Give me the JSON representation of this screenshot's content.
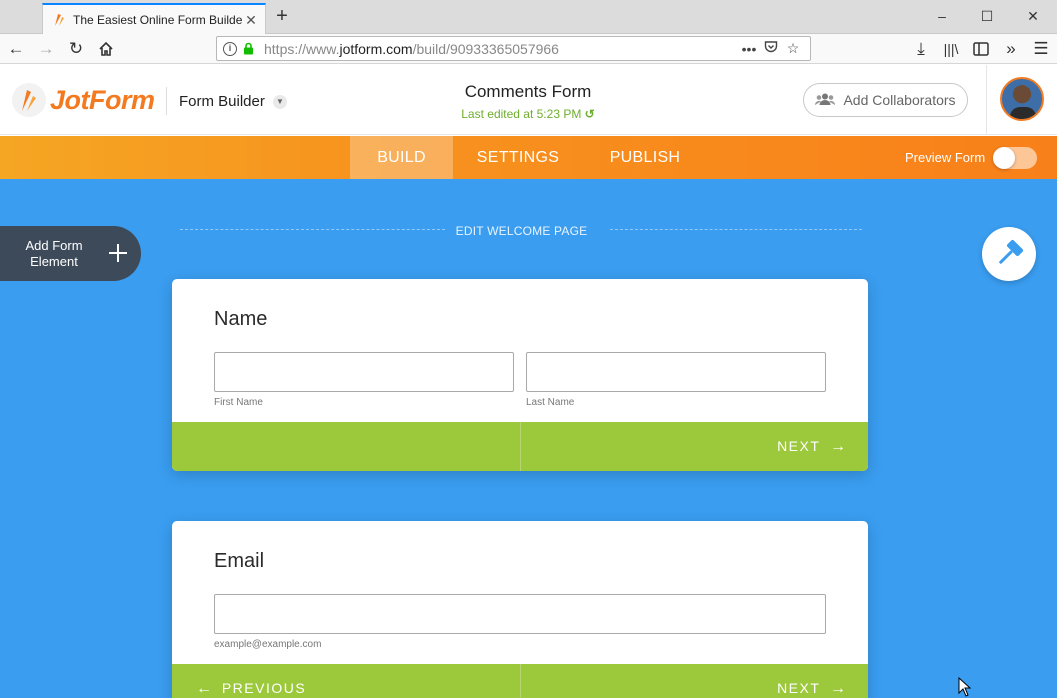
{
  "browser": {
    "tab_title": "The Easiest Online Form Builder",
    "new_tab_symbol": "+",
    "url_prefix": "https://www.",
    "url_host": "jotform.com",
    "url_path": "/build/90933365057966"
  },
  "header": {
    "logo_text": "JotForm",
    "builder_label": "Form Builder",
    "form_title": "Comments Form",
    "last_edited": "Last edited at 5:23 PM",
    "collaborators_label": "Add Collaborators"
  },
  "nav": {
    "tabs": [
      {
        "label": "BUILD",
        "active": true
      },
      {
        "label": "SETTINGS",
        "active": false
      },
      {
        "label": "PUBLISH",
        "active": false
      }
    ],
    "preview_label": "Preview Form",
    "preview_on": false
  },
  "canvas": {
    "welcome_label": "EDIT WELCOME PAGE",
    "add_element_label": "Add Form Element",
    "add_element_icon": "plus-icon",
    "designer_icon": "paint-roller-icon"
  },
  "questions": [
    {
      "label": "Name",
      "sublabels": [
        "First Name",
        "Last Name"
      ],
      "next_label": "NEXT"
    },
    {
      "label": "Email",
      "sublabels": [
        "example@example.com"
      ],
      "prev_label": "PREVIOUS",
      "next_label": "NEXT"
    }
  ],
  "colors": {
    "accent_orange": "#f47a20",
    "canvas_blue": "#3a9df0",
    "footer_green": "#9cc83b",
    "edited_green": "#6fae2e"
  }
}
